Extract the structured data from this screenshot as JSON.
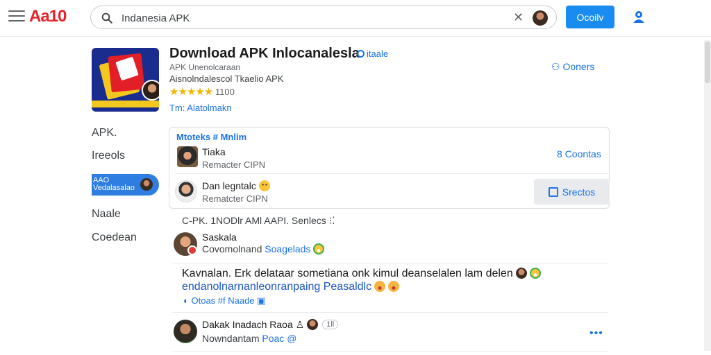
{
  "header": {
    "brand": "Aa10",
    "search_value": "Indanesia APK",
    "primary_button": "Ocoilv",
    "icons": {
      "menu": "hamburger-icon",
      "search": "search-icon",
      "clear": "close-icon",
      "account": "user-icon"
    }
  },
  "app": {
    "title": "Download APK Inlocanalesla",
    "verified_label": "itaale",
    "line1": "APK Unenolcaraan",
    "line2": "Aisnolndalescol Tkaelio APK",
    "stars": "★★★★★",
    "rating": "1100",
    "developer": "Tm: Alatolmakn",
    "top_link": "Ooners"
  },
  "sidebar": {
    "items": [
      {
        "label": "APK."
      },
      {
        "label": "Ireeols"
      },
      {
        "label": "AAO Vedalasalao"
      },
      {
        "label": "Naale"
      },
      {
        "label": "Coedean"
      }
    ]
  },
  "panel": {
    "header": "Mtoteks # Mnlim",
    "rows": [
      {
        "title": "Tiaka",
        "subtitle": "Remacter CIPN",
        "action": "8 Coontas"
      },
      {
        "title": "Dan legntalc",
        "subtitle": "Rematcter CIPN",
        "action": "Srectos"
      }
    ]
  },
  "feed": {
    "section_title": "C-PK. 1NODlr AMl AAPI. Senlecs",
    "items": [
      {
        "title": "Saskala",
        "subtitle_prefix": "Covomolnand",
        "subtitle_link": "Soagelads"
      },
      {
        "body_line1": "Kavnalan. Erk delataar sometiana onk kimul deanselalen lam delen",
        "body_line2": "endanolnarnanleonranpaing Peasaldlc",
        "meta": "Otoas #f Naade"
      },
      {
        "title": "Dakak Inadach Raoa",
        "count": "1ll",
        "subtitle_prefix": "Nowndantam",
        "subtitle_link": "Poac"
      }
    ]
  },
  "colors": {
    "accent": "#1a8cf0",
    "brand": "#e8222b",
    "link": "#1a73e8"
  }
}
